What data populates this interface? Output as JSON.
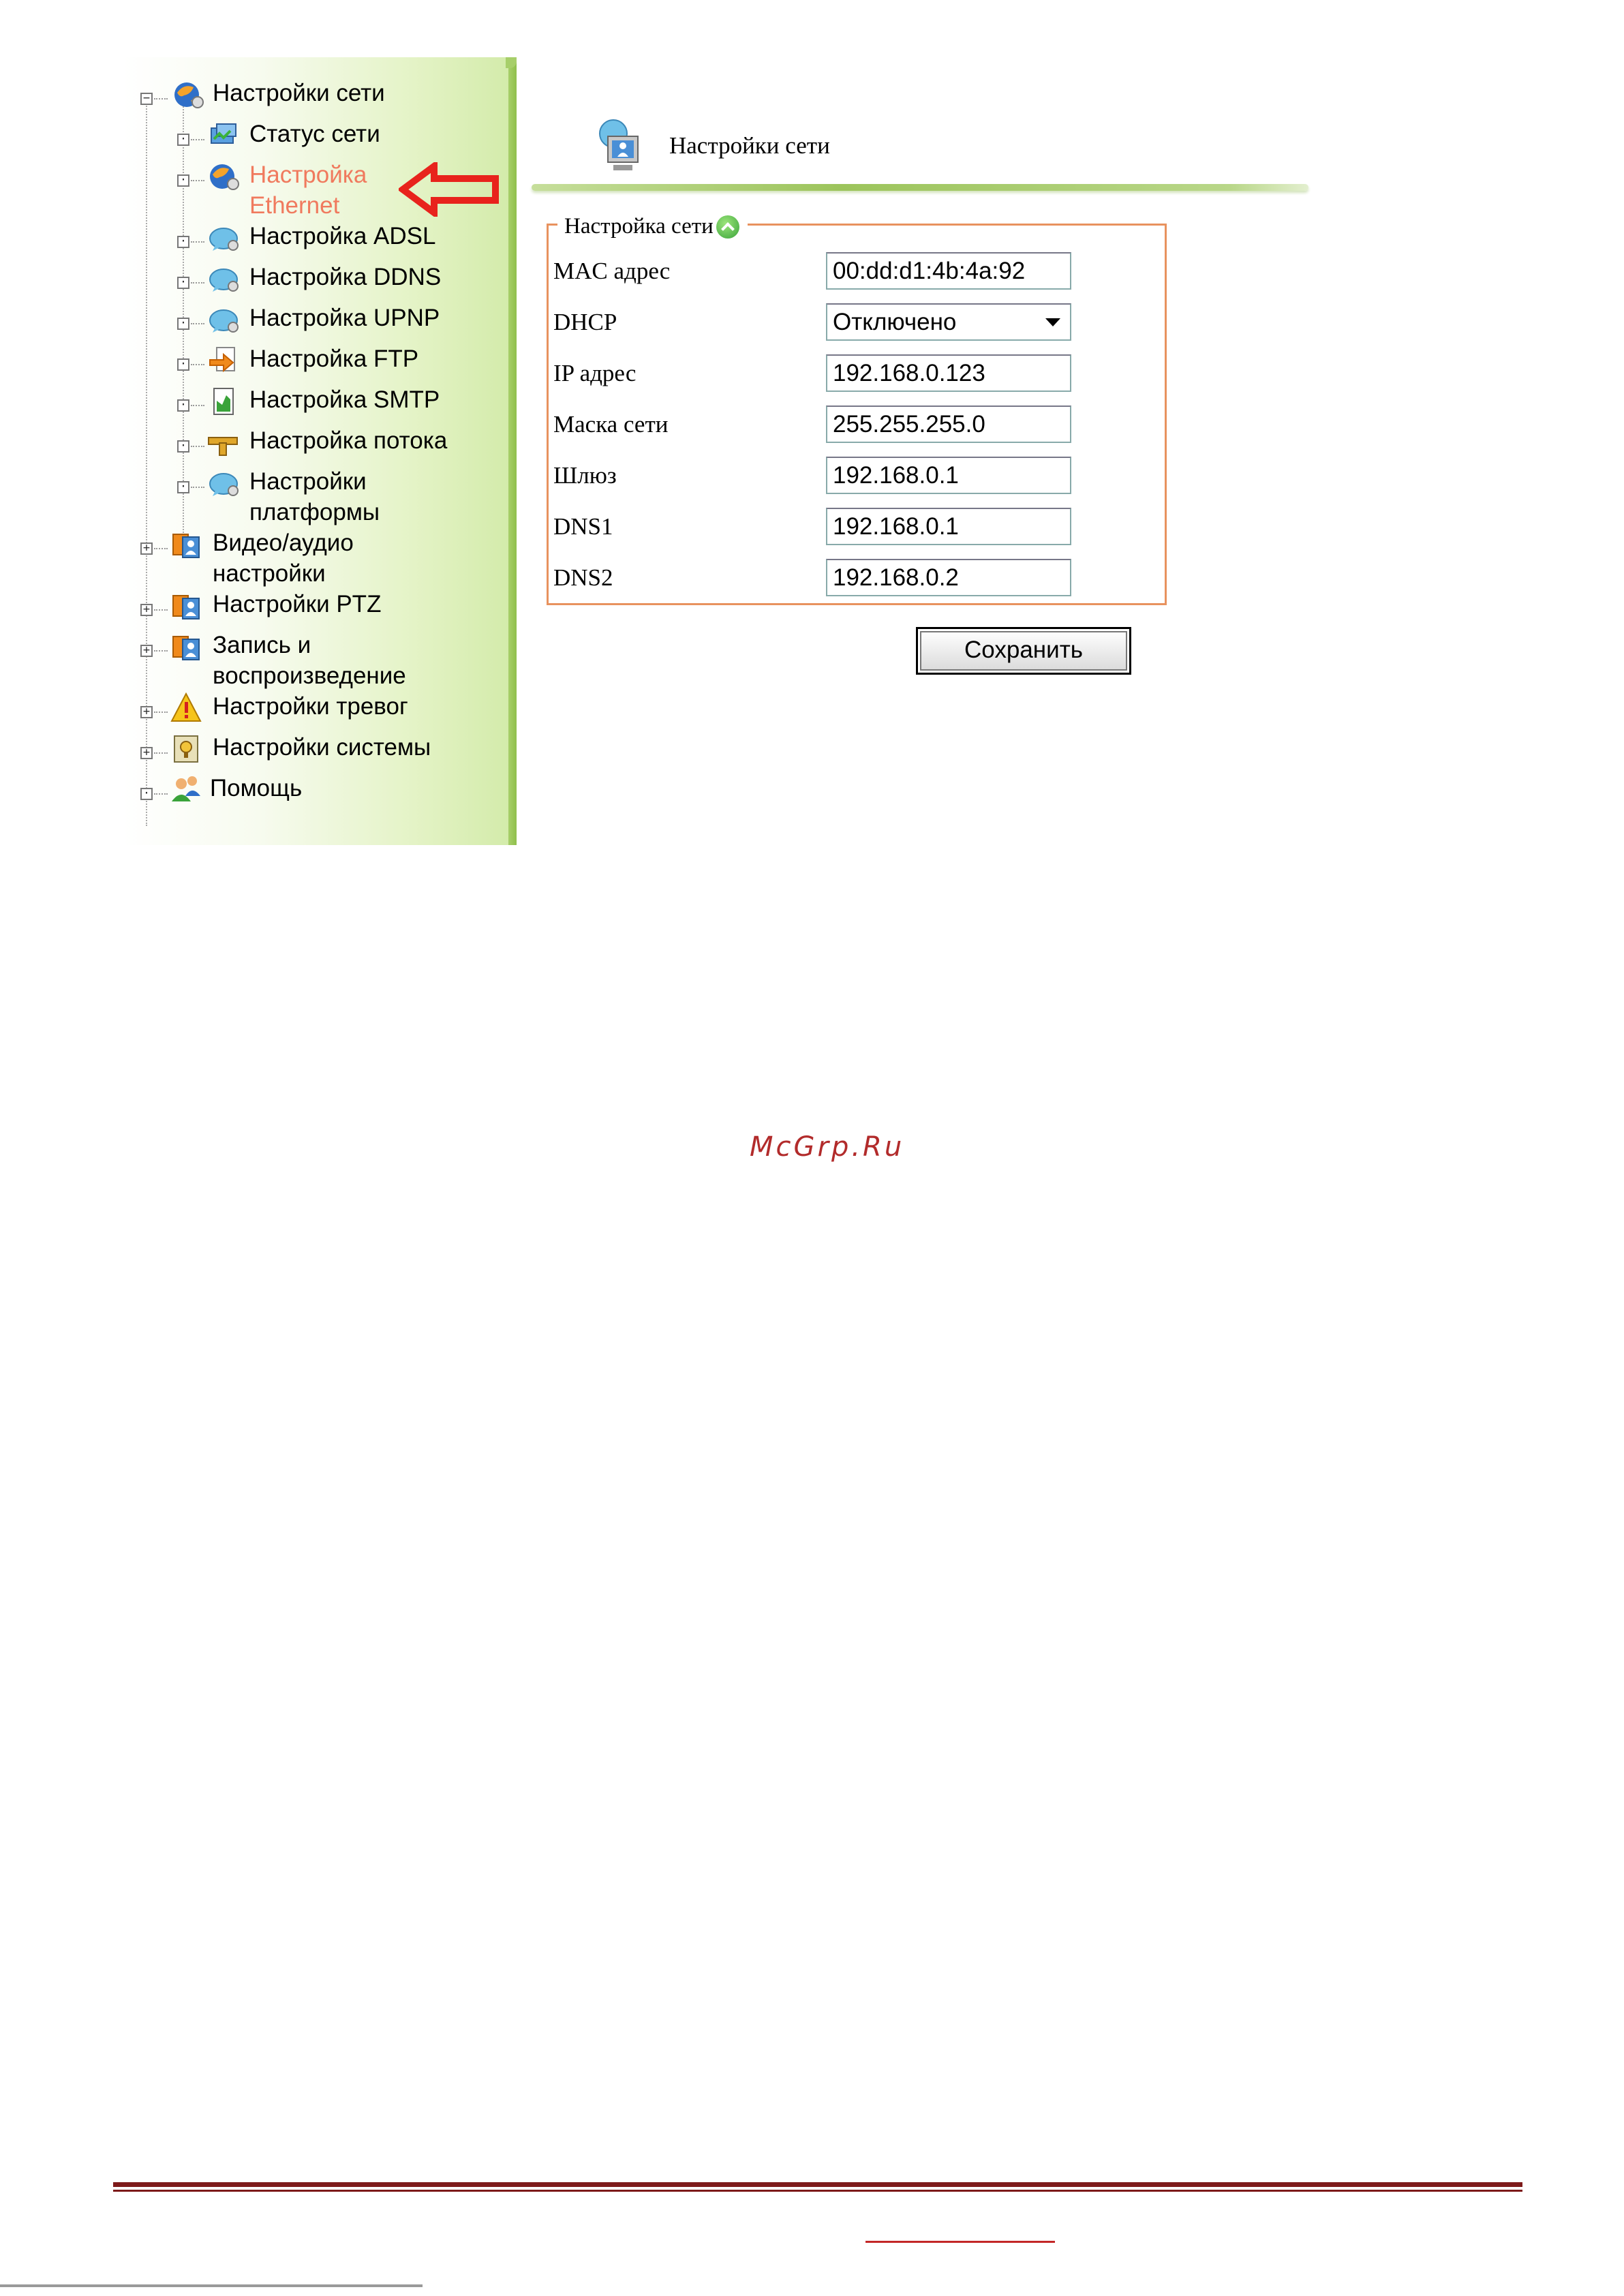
{
  "sidebar": {
    "items": [
      {
        "label": "Настройки сети",
        "level": 0,
        "expanded": true,
        "icon": "network-globe-icon"
      },
      {
        "label": "Статус сети",
        "level": 1,
        "icon": "network-status-icon"
      },
      {
        "label": "Настройка Ethernet",
        "level": 1,
        "icon": "ethernet-globe-icon",
        "active": true
      },
      {
        "label": "Настройка ADSL",
        "level": 1,
        "icon": "globe-chat-icon"
      },
      {
        "label": "Настройка DDNS",
        "level": 1,
        "icon": "globe-chat-icon"
      },
      {
        "label": "Настройка UPNP",
        "level": 1,
        "icon": "globe-chat-icon"
      },
      {
        "label": "Настройка FTP",
        "level": 1,
        "icon": "ftp-arrow-icon"
      },
      {
        "label": "Настройка SMTP",
        "level": 1,
        "icon": "smtp-chart-icon"
      },
      {
        "label": "Настройка потока",
        "level": 1,
        "icon": "stream-pipe-icon"
      },
      {
        "label": "Настройки платформы",
        "level": 1,
        "icon": "globe-chat-icon"
      },
      {
        "label": "Видео/аудио настройки",
        "level": 0,
        "icon": "camera-user-icon"
      },
      {
        "label": "Настройки PTZ",
        "level": 0,
        "icon": "camera-user-icon"
      },
      {
        "label": "Запись и воспроизведение",
        "level": 0,
        "icon": "camera-user-icon"
      },
      {
        "label": "Настройки тревог",
        "level": 0,
        "icon": "warning-icon"
      },
      {
        "label": "Настройки системы",
        "level": 0,
        "icon": "system-settings-icon"
      },
      {
        "label": "Помощь",
        "level": 0,
        "icon": "help-users-icon"
      }
    ],
    "active_color": "#f07a5e"
  },
  "header": {
    "title": "Настройки сети",
    "icon": "network-computer-icon"
  },
  "form": {
    "legend": "Настройка сети",
    "fields": [
      {
        "label": "MAC адрес",
        "value": "00:dd:d1:4b:4a:92"
      },
      {
        "label": "DHCP",
        "value": "Отключено",
        "type": "select"
      },
      {
        "label": "IP адрес",
        "value": "192.168.0.123"
      },
      {
        "label": "Маска сети",
        "value": "255.255.255.0"
      },
      {
        "label": "Шлюз",
        "value": "192.168.0.1"
      },
      {
        "label": "DNS1",
        "value": "192.168.0.1"
      },
      {
        "label": "DNS2",
        "value": "192.168.0.2"
      }
    ],
    "save_label": "Сохранить",
    "border_color": "#e8925e"
  },
  "watermark": "McGrp.Ru",
  "colors": {
    "annotation_arrow": "#e8231c",
    "footer_rule": "#7d1a1a"
  }
}
